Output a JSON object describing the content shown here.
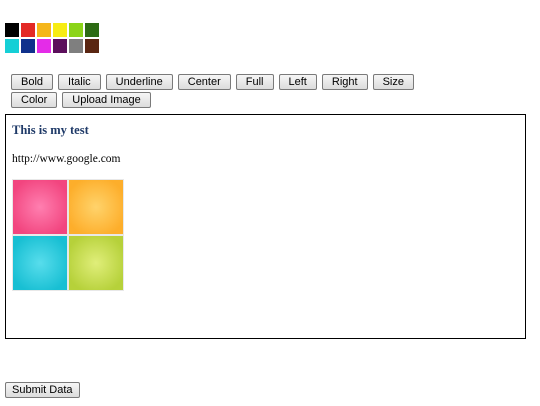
{
  "palette": {
    "colors": [
      "#000000",
      "#e32926",
      "#f5b61b",
      "#f7ec13",
      "#8bd418",
      "#2d6b14",
      "#15cfd6",
      "#10318c",
      "#e42ce8",
      "#5c0f5c",
      "#7f7f7f",
      "#5a2612"
    ]
  },
  "toolbar": {
    "bold": "Bold",
    "italic": "Italic",
    "underline": "Underline",
    "center": "Center",
    "full": "Full",
    "left": "Left",
    "right": "Right",
    "size": "Size",
    "color": "Color",
    "upload_image": "Upload Image"
  },
  "editor": {
    "title": "This is my test",
    "link": "http://www.google.com",
    "image_tiles": [
      "pink",
      "orange",
      "cyan",
      "lime"
    ]
  },
  "form": {
    "submit_label": "Submit Data"
  }
}
